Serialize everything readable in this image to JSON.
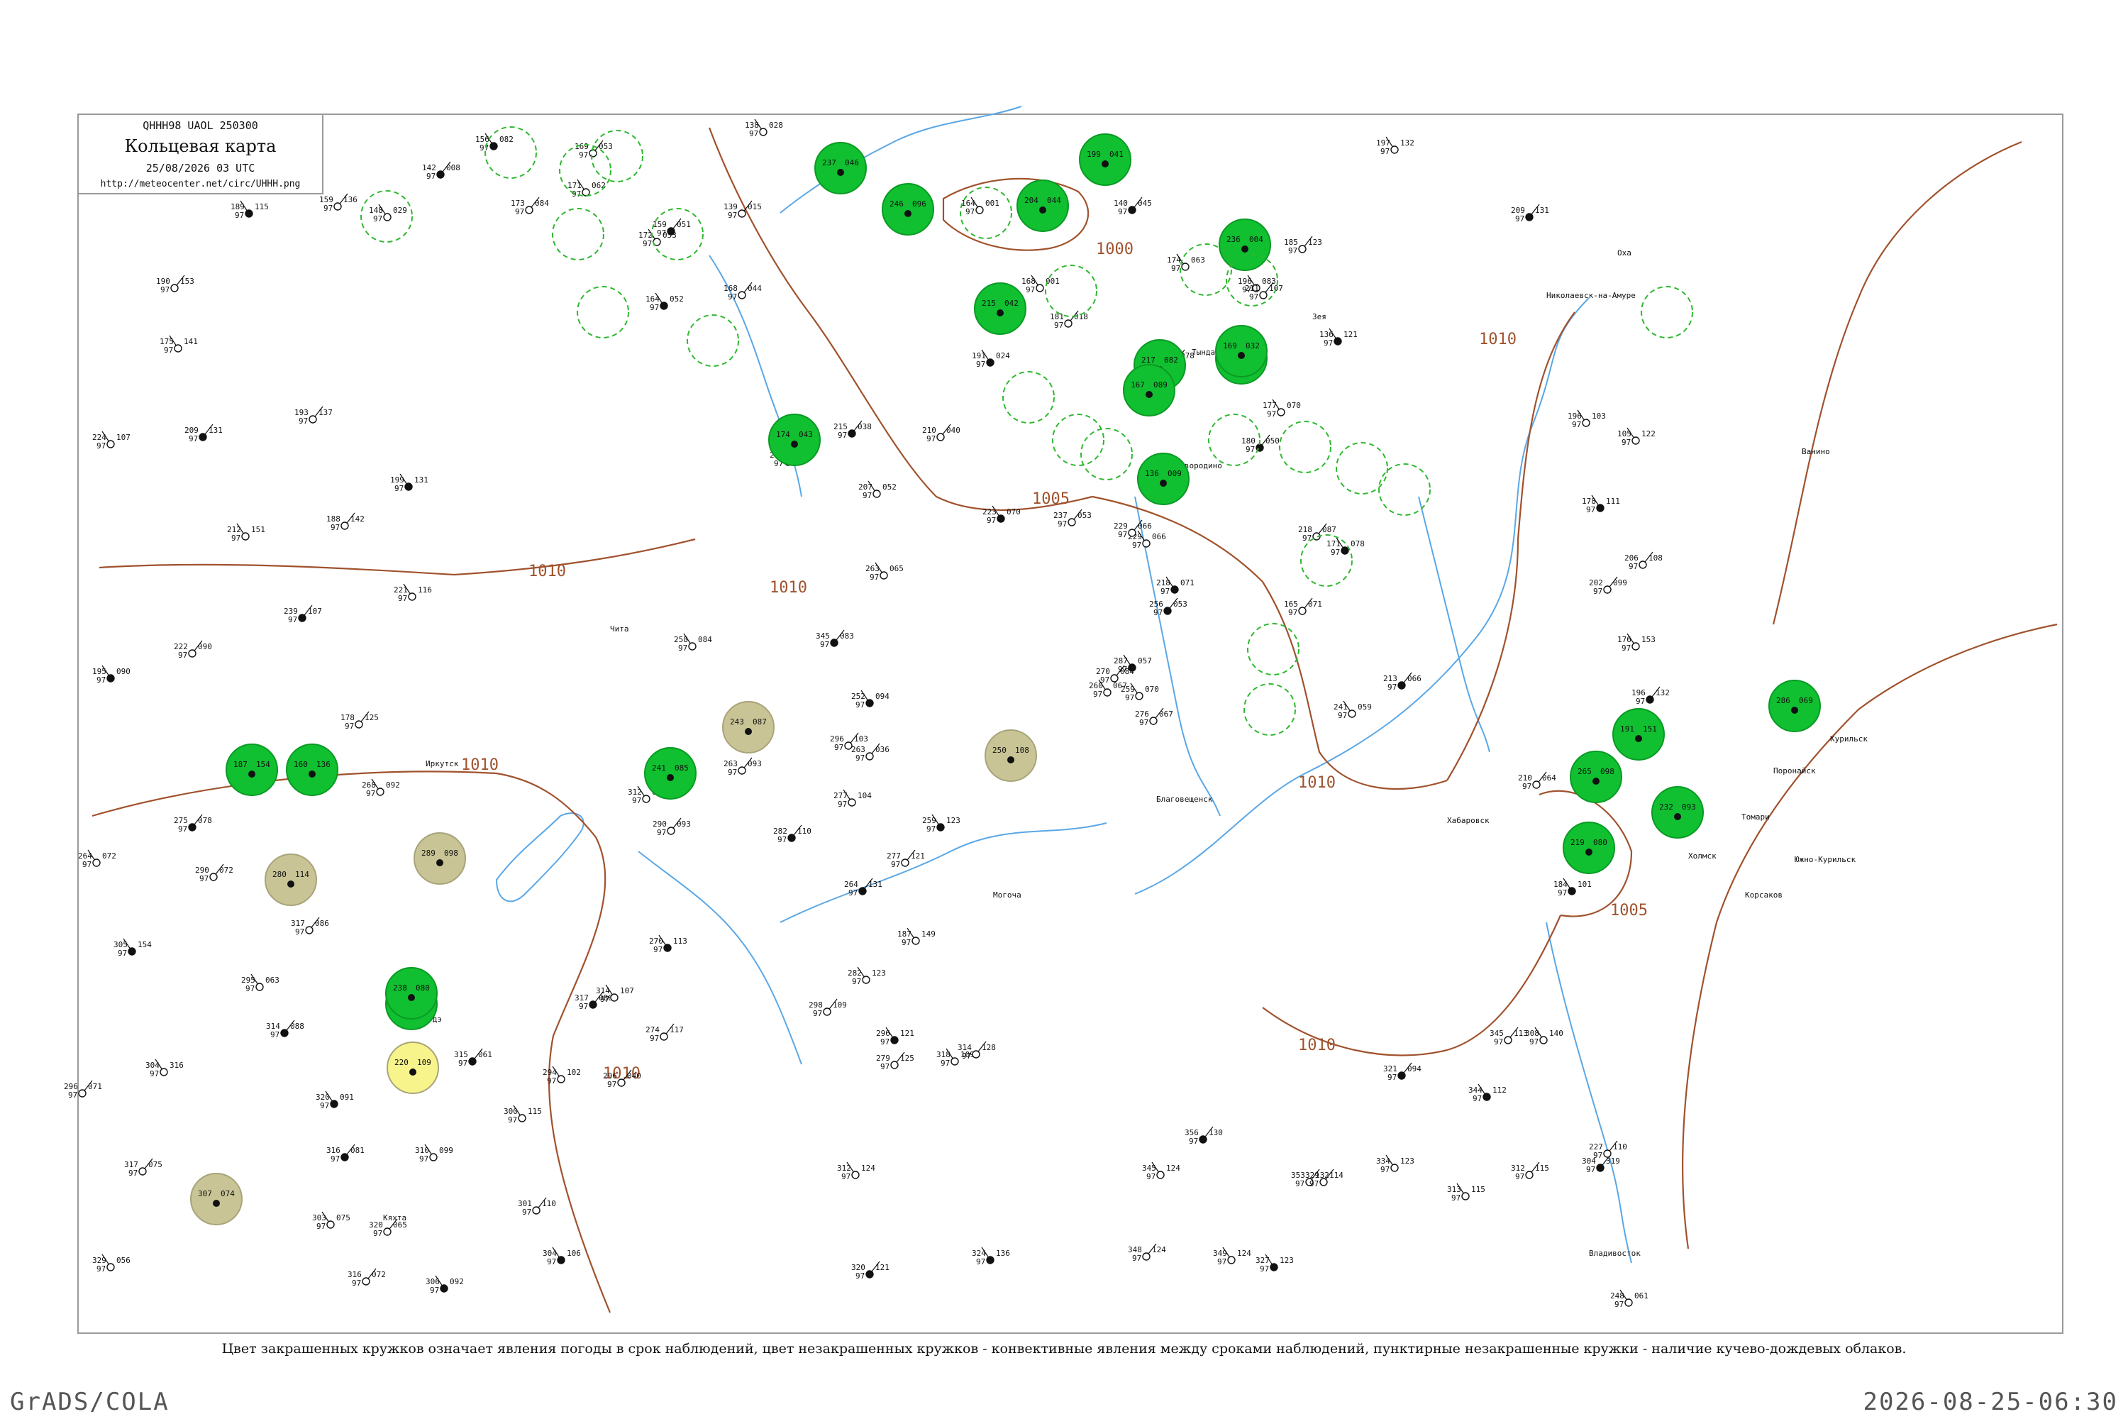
{
  "header": {
    "code_line": "QHHH98  UAOL  250300",
    "title": "Кольцевая карта",
    "datetime": "25/08/2026 03 UTC",
    "url": "http://meteocenter.net/circ/UHHH.png"
  },
  "isobars": [
    "1000",
    "1005",
    "1010",
    "1010",
    "1010",
    "1010",
    "1010",
    "1005",
    "1010",
    "1010"
  ],
  "colors": {
    "precip_circle": "#10c030",
    "haze_circle": "#c8c496",
    "fog_circle": "#f7f48c",
    "convective_dash": "#2eb82e",
    "isobar": "#a0522d",
    "river": "#5aa7e6",
    "frame": "#9a9a9a"
  },
  "stations": [
    {
      "t": "156",
      "d": "97",
      "p": "082"
    },
    {
      "t": "169",
      "d": "97",
      "p": "053"
    },
    {
      "t": "164",
      "d": "97",
      "p": "001"
    },
    {
      "t": "142",
      "d": "97",
      "p": "008"
    },
    {
      "t": "148",
      "d": "97",
      "p": "029"
    },
    {
      "t": "159",
      "d": "97",
      "p": "136"
    },
    {
      "t": "189",
      "d": "97",
      "p": "115"
    },
    {
      "t": "173",
      "d": "97",
      "p": "084"
    },
    {
      "t": "171",
      "d": "97",
      "p": "062"
    },
    {
      "t": "159",
      "d": "97",
      "p": "051"
    },
    {
      "t": "172",
      "d": "97",
      "p": "053"
    },
    {
      "t": "168",
      "d": "97",
      "p": "044"
    },
    {
      "t": "164",
      "d": "97",
      "p": "052"
    },
    {
      "t": "190",
      "d": "97",
      "p": "153"
    },
    {
      "t": "175",
      "d": "97",
      "p": "141"
    },
    {
      "t": "209",
      "d": "97",
      "p": "131"
    },
    {
      "t": "224",
      "d": "97",
      "p": "107"
    },
    {
      "t": "193",
      "d": "97",
      "p": "137"
    },
    {
      "t": "199",
      "d": "97",
      "p": "131"
    },
    {
      "t": "188",
      "d": "97",
      "p": "142"
    },
    {
      "t": "212",
      "d": "97",
      "p": "151"
    },
    {
      "t": "239",
      "d": "97",
      "p": "107"
    },
    {
      "t": "221",
      "d": "97",
      "p": "116"
    },
    {
      "t": "222",
      "d": "97",
      "p": "090"
    },
    {
      "t": "195",
      "d": "97",
      "p": "090"
    },
    {
      "t": "178",
      "d": "97",
      "p": "125"
    },
    {
      "t": "268",
      "d": "97",
      "p": "092"
    },
    {
      "t": "275",
      "d": "97",
      "p": "078"
    },
    {
      "t": "264",
      "d": "97",
      "p": "072"
    },
    {
      "t": "290",
      "d": "97",
      "p": "072"
    },
    {
      "t": "305",
      "d": "97",
      "p": "154"
    },
    {
      "t": "317",
      "d": "97",
      "p": "086"
    },
    {
      "t": "295",
      "d": "97",
      "p": "063"
    },
    {
      "t": "314",
      "d": "97",
      "p": "088"
    },
    {
      "t": "304",
      "d": "97",
      "p": "316"
    },
    {
      "t": "296",
      "d": "97",
      "p": "071"
    },
    {
      "t": "320",
      "d": "97",
      "p": "091"
    },
    {
      "t": "317",
      "d": "97",
      "p": "075"
    },
    {
      "t": "329",
      "d": "97",
      "p": "056"
    },
    {
      "t": "316",
      "d": "97",
      "p": "081"
    },
    {
      "t": "303",
      "d": "97",
      "p": "075"
    },
    {
      "t": "320",
      "d": "97",
      "p": "065"
    },
    {
      "t": "306",
      "d": "97",
      "p": "092"
    },
    {
      "t": "316",
      "d": "97",
      "p": "072"
    },
    {
      "t": "310",
      "d": "97",
      "p": "099"
    },
    {
      "t": "315",
      "d": "97",
      "p": "061"
    },
    {
      "t": "300",
      "d": "97",
      "p": "115"
    },
    {
      "t": "301",
      "d": "97",
      "p": "110"
    },
    {
      "t": "304",
      "d": "97",
      "p": "106"
    },
    {
      "t": "296",
      "d": "97",
      "p": "040"
    },
    {
      "t": "294",
      "d": "97",
      "p": "102"
    },
    {
      "t": "317",
      "d": "97",
      "p": "086"
    },
    {
      "t": "314",
      "d": "97",
      "p": "107"
    },
    {
      "t": "274",
      "d": "97",
      "p": "117"
    },
    {
      "t": "270",
      "d": "97",
      "p": "113"
    },
    {
      "t": "290",
      "d": "97",
      "p": "093"
    },
    {
      "t": "312",
      "d": "97",
      "p": "099"
    },
    {
      "t": "282",
      "d": "97",
      "p": "110"
    },
    {
      "t": "277",
      "d": "97",
      "p": "104"
    },
    {
      "t": "296",
      "d": "97",
      "p": "103"
    },
    {
      "t": "252",
      "d": "97",
      "p": "094"
    },
    {
      "t": "263",
      "d": "97",
      "p": "093"
    },
    {
      "t": "258",
      "d": "97",
      "p": "084"
    },
    {
      "t": "345",
      "d": "97",
      "p": "083"
    },
    {
      "t": "263",
      "d": "97",
      "p": "065"
    },
    {
      "t": "263",
      "d": "97",
      "p": "036"
    },
    {
      "t": "259",
      "d": "97",
      "p": "123"
    },
    {
      "t": "277",
      "d": "97",
      "p": "121"
    },
    {
      "t": "187",
      "d": "97",
      "p": "149"
    },
    {
      "t": "264",
      "d": "97",
      "p": "131"
    },
    {
      "t": "282",
      "d": "97",
      "p": "123"
    },
    {
      "t": "298",
      "d": "97",
      "p": "109"
    },
    {
      "t": "296",
      "d": "97",
      "p": "121"
    },
    {
      "t": "279",
      "d": "97",
      "p": "125"
    },
    {
      "t": "312",
      "d": "97",
      "p": "124"
    },
    {
      "t": "320",
      "d": "97",
      "p": "121"
    },
    {
      "t": "318",
      "d": "97",
      "p": "109"
    },
    {
      "t": "314",
      "d": "97",
      "p": "128"
    },
    {
      "t": "324",
      "d": "97",
      "p": "136"
    },
    {
      "t": "348",
      "d": "97",
      "p": "124"
    },
    {
      "t": "345",
      "d": "97",
      "p": "124"
    },
    {
      "t": "356",
      "d": "97",
      "p": "130"
    },
    {
      "t": "349",
      "d": "97",
      "p": "124"
    },
    {
      "t": "353",
      "d": "97",
      "p": "132"
    },
    {
      "t": "327",
      "d": "97",
      "p": "123"
    },
    {
      "t": "329",
      "d": "97",
      "p": "114"
    },
    {
      "t": "334",
      "d": "97",
      "p": "123"
    },
    {
      "t": "321",
      "d": "97",
      "p": "094"
    },
    {
      "t": "313",
      "d": "97",
      "p": "115"
    },
    {
      "t": "345",
      "d": "97",
      "p": "113"
    },
    {
      "t": "344",
      "d": "97",
      "p": "112"
    },
    {
      "t": "312",
      "d": "97",
      "p": "115"
    },
    {
      "t": "308",
      "d": "97",
      "p": "140"
    },
    {
      "t": "304",
      "d": "97",
      "p": "319"
    },
    {
      "t": "248",
      "d": "97",
      "p": "061"
    },
    {
      "t": "227",
      "d": "97",
      "p": "110"
    },
    {
      "t": "184",
      "d": "97",
      "p": "101"
    },
    {
      "t": "210",
      "d": "97",
      "p": "064"
    },
    {
      "t": "176",
      "d": "97",
      "p": "153"
    },
    {
      "t": "196",
      "d": "97",
      "p": "132"
    },
    {
      "t": "105",
      "d": "97",
      "p": "122"
    },
    {
      "t": "206",
      "d": "97",
      "p": "108"
    },
    {
      "t": "178",
      "d": "97",
      "p": "111"
    },
    {
      "t": "202",
      "d": "97",
      "p": "099"
    },
    {
      "t": "196",
      "d": "97",
      "p": "103"
    },
    {
      "t": "213",
      "d": "97",
      "p": "066"
    },
    {
      "t": "241",
      "d": "97",
      "p": "059"
    },
    {
      "t": "218",
      "d": "97",
      "p": "087"
    },
    {
      "t": "171",
      "d": "97",
      "p": "078"
    },
    {
      "t": "165",
      "d": "97",
      "p": "071"
    },
    {
      "t": "177",
      "d": "97",
      "p": "070"
    },
    {
      "t": "180",
      "d": "97",
      "p": "050"
    },
    {
      "t": "196",
      "d": "97",
      "p": "083"
    },
    {
      "t": "211",
      "d": "97",
      "p": "107"
    },
    {
      "t": "136",
      "d": "97",
      "p": "121"
    },
    {
      "t": "185",
      "d": "97",
      "p": "123"
    },
    {
      "t": "197",
      "d": "97",
      "p": "132"
    },
    {
      "t": "209",
      "d": "97",
      "p": "131"
    },
    {
      "t": "259",
      "d": "97",
      "p": "070"
    },
    {
      "t": "276",
      "d": "97",
      "p": "067"
    },
    {
      "t": "287",
      "d": "97",
      "p": "057"
    },
    {
      "t": "270",
      "d": "97",
      "p": "084"
    },
    {
      "t": "260",
      "d": "97",
      "p": "067"
    },
    {
      "t": "256",
      "d": "97",
      "p": "053"
    },
    {
      "t": "229",
      "d": "97",
      "p": "066"
    },
    {
      "t": "237",
      "d": "97",
      "p": "053"
    },
    {
      "t": "223",
      "d": "97",
      "p": "070"
    },
    {
      "t": "210",
      "d": "97",
      "p": "040"
    },
    {
      "t": "207",
      "d": "97",
      "p": "052"
    },
    {
      "t": "215",
      "d": "97",
      "p": "038"
    },
    {
      "t": "203",
      "d": "97",
      "p": "045"
    },
    {
      "t": "229",
      "d": "97",
      "p": "066"
    },
    {
      "t": "218",
      "d": "97",
      "p": "071"
    },
    {
      "t": "139",
      "d": "97",
      "p": "015"
    },
    {
      "t": "138",
      "d": "97",
      "p": "028"
    },
    {
      "t": "140",
      "d": "97",
      "p": "045"
    },
    {
      "t": "174",
      "d": "97",
      "p": "063"
    },
    {
      "t": "229",
      "d": "97",
      "p": "078"
    },
    {
      "t": "191",
      "d": "97",
      "p": "024"
    },
    {
      "t": "181",
      "d": "97",
      "p": "018"
    },
    {
      "t": "168",
      "d": "97",
      "p": "001"
    }
  ],
  "station_names": [
    "Томари",
    "Холмск",
    "Корсаков",
    "Поронайск",
    "Оха",
    "Николаевск-на-Амуре",
    "Хабаровск",
    "Владивосток",
    "Чита",
    "Иркутск",
    "Улан-Удэ",
    "Благовещенск",
    "Кяхта",
    "Зея",
    "Тында",
    "Могоча",
    "Сковородино",
    "Ванино",
    "Курильск",
    "Южно-Курильск"
  ],
  "markers": [
    {
      "type": "precip",
      "t": "237",
      "p": "046"
    },
    {
      "type": "precip",
      "t": "246",
      "p": "096"
    },
    {
      "type": "precip",
      "t": "204",
      "p": "044"
    },
    {
      "type": "precip",
      "t": "199",
      "p": "041"
    },
    {
      "type": "precip",
      "t": "236",
      "p": "004"
    },
    {
      "type": "precip",
      "t": "215",
      "p": "042"
    },
    {
      "type": "precip",
      "t": "217",
      "p": "082"
    },
    {
      "type": "precip",
      "t": "154",
      "p": "039"
    },
    {
      "type": "precip",
      "t": "136",
      "p": "009"
    },
    {
      "type": "precip",
      "t": "167",
      "p": "089"
    },
    {
      "type": "precip",
      "t": "169",
      "p": "032"
    },
    {
      "type": "precip",
      "t": "174",
      "p": "043"
    },
    {
      "type": "precip",
      "t": "187",
      "p": "154"
    },
    {
      "type": "precip",
      "t": "160",
      "p": "136"
    },
    {
      "type": "precip",
      "t": "241",
      "p": "085"
    },
    {
      "type": "precip",
      "t": "265",
      "p": "098"
    },
    {
      "type": "precip",
      "t": "191",
      "p": "151"
    },
    {
      "type": "precip",
      "t": "286",
      "p": "069"
    },
    {
      "type": "precip",
      "t": "219",
      "p": "080"
    },
    {
      "type": "precip",
      "t": "232",
      "p": "093"
    },
    {
      "type": "precip",
      "t": "233",
      "p": "088"
    },
    {
      "type": "precip",
      "t": "238",
      "p": "080"
    },
    {
      "type": "haze",
      "t": "243",
      "p": "087"
    },
    {
      "type": "haze",
      "t": "250",
      "p": "108"
    },
    {
      "type": "haze",
      "t": "289",
      "p": "098"
    },
    {
      "type": "haze",
      "t": "280",
      "p": "114"
    },
    {
      "type": "haze",
      "t": "307",
      "p": "074"
    },
    {
      "type": "fog",
      "t": "220",
      "p": "109"
    }
  ],
  "caption": "Цвет закрашенных кружков означает явления погоды в срок наблюдений, цвет незакрашенных кружков - конвективные явления между сроками наблюдений, пунктирные незакрашенные кружки - наличие кучево-дождевых облаков.",
  "footer": {
    "left": "GrADS/COLA",
    "right": "2026-08-25-06:30"
  }
}
